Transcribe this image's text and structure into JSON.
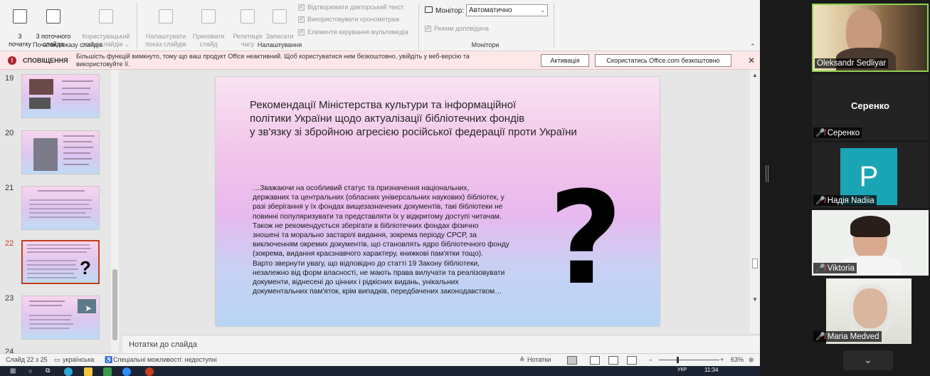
{
  "ribbon": {
    "buttons": {
      "from_start": "3\nпочатку",
      "from_current": "3 поточного\nслайда",
      "custom_show": "Користувацький\nпоказ слайдів ⌄",
      "setup_show": "Налаштувати\nпоказ слайдів",
      "hide_slide": "Приховати\nслайд",
      "rehearse": "Репетиція\nчасу",
      "record": "Записати\n⌄"
    },
    "checkboxes": {
      "narrations": "Відтворювати дикторський текст",
      "timings": "Використовувати хронометраж",
      "media_controls": "Елементи керування мультимедіа",
      "presenter_view": "Режим доповідача"
    },
    "monitor_label": "Монітор:",
    "monitor_value": "Автоматично",
    "groups": {
      "start": "Початок показу слайдів",
      "setup": "Налаштування",
      "monitors": "Монітори"
    }
  },
  "notification": {
    "title": "СПОВІЩЕННЯ",
    "text": "Більшість функцій вимкнуто, тому що ваш продукт Office неактивний. Щоб користуватися ним безкоштовно, увійдіть у веб-версію та використовуйте її.",
    "activate_label": "Активація",
    "office_com_label": "Скористатись Office.com безкоштовно"
  },
  "thumbnails": {
    "numbers": [
      "19",
      "20",
      "21",
      "22",
      "23",
      "24"
    ],
    "active": "22"
  },
  "slide": {
    "title": "Рекомендації Міністерства культури та інформаційної\nполітики України щодо актуалізації бібліотечних фондів\nу зв'язку зі збройною агресією російської федерації проти України",
    "body": "…Зважаючи на особливий статус та призначення національних,\nдержавних та центральних (обласних універсальних наукових) бібліотек, у\nразі зберігання у їх фондах вищезазначених документів, такі бібліотеки не\nповинні популяризувати та представляти їх у відкритому доступі читачам.\nТакож не рекомендується зберігати в бібліотечних фондах фізично\nзношені та морально застарілі видання, зокрема періоду СРСР, за\nвиключенням окремих документів, що становлять ядро бібліотечного фонду\n(зокрема, видання краєзнавчого характеру, книжкові пам'ятки тощо).\nВарто звернути увагу, що відповідно до статті 19 Закону бібліотеки,\nнезалежно від форм власності, не мають права вилучати та реалізовувати\nдокументи, віднесені до цінних і рідкісних видань, унікальних\nдокументальних пам'яток, крім випадків, передбачених законодавством…",
    "symbol": "?"
  },
  "notes_placeholder": "Нотатки до слайда",
  "status": {
    "slide_counter": "Слайд 22 з 25",
    "language": "українська",
    "accessibility": "Спеціальні можливості: недоступні",
    "notes_button": "Нотатки",
    "zoom": "63%"
  },
  "taskbar": {
    "time": "11:34",
    "lang": "УКР"
  },
  "participants": [
    {
      "name": "Oleksandr Sedliyar",
      "muted": false,
      "video": true
    },
    {
      "name": "Серенко",
      "muted": true,
      "video": false,
      "display": "Серенко"
    },
    {
      "name": "Надія Nadiia",
      "muted": true,
      "video": false,
      "initial": "P"
    },
    {
      "name": "Viktoria",
      "muted": true,
      "video": true
    },
    {
      "name": "Maria Medved",
      "muted": true,
      "video": true
    }
  ],
  "colors": {
    "accent": "#c43e1c",
    "active_speaker": "#8fd14f",
    "avatar_bg": "#1aa5b5",
    "notification_bg": "#fde7e9"
  }
}
